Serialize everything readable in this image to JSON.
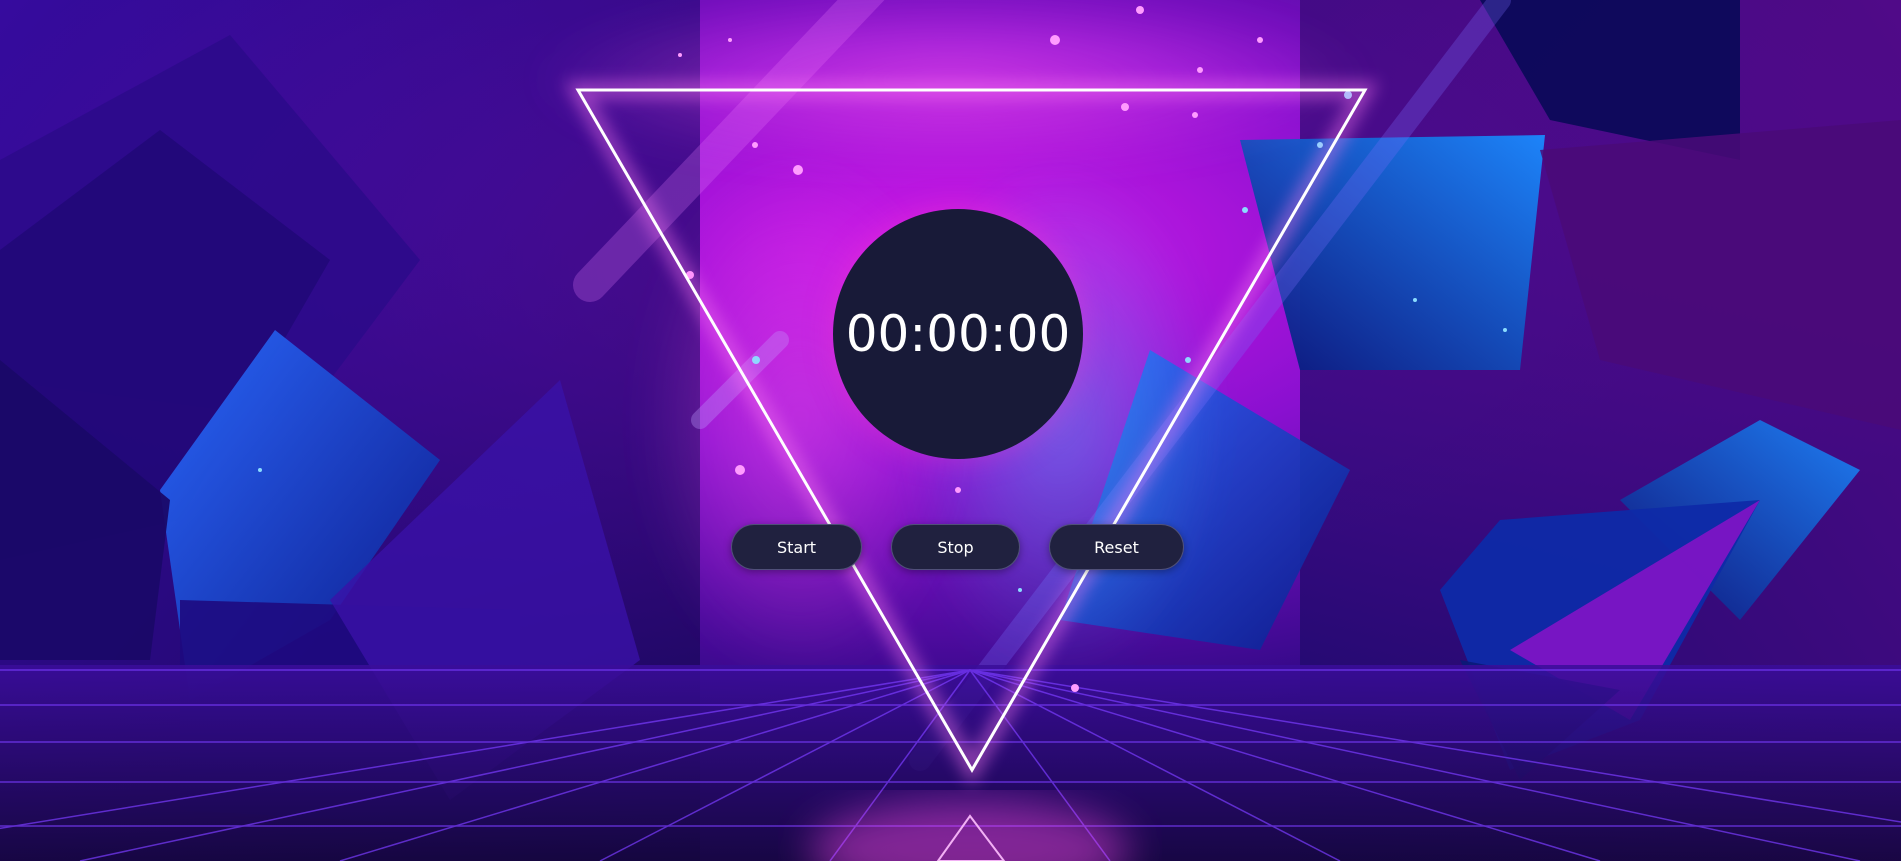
{
  "timer": {
    "display": "00:00:00"
  },
  "controls": {
    "start_label": "Start",
    "stop_label": "Stop",
    "reset_label": "Reset"
  },
  "theme": {
    "background_primary": "#2a0a6a",
    "background_magenta": "#b012d8",
    "background_blue": "#1a3ad8",
    "timer_circle": "#181a38",
    "button_bg": "#20213f",
    "text": "#ffffff",
    "neon_triangle": "#ffffff"
  }
}
